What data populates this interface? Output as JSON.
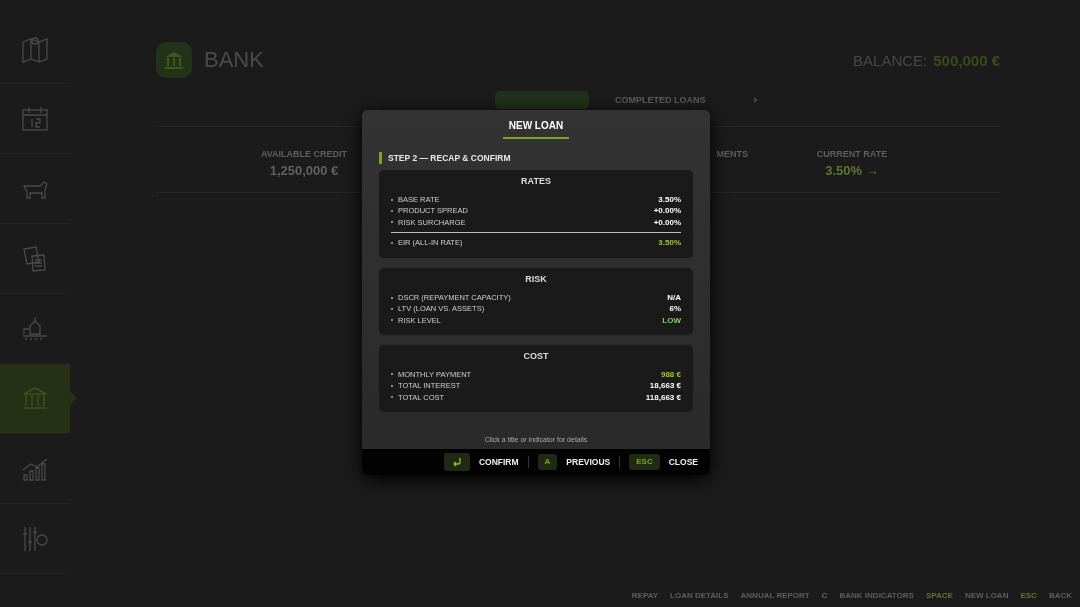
{
  "sidebar": {
    "items": [
      {
        "selected": false
      },
      {
        "selected": false
      },
      {
        "selected": false
      },
      {
        "selected": false
      },
      {
        "selected": false
      },
      {
        "selected": true
      },
      {
        "selected": false
      },
      {
        "selected": false
      }
    ]
  },
  "header": {
    "title": "BANK",
    "balance_label": "BALANCE:",
    "balance_value": "500,000 €"
  },
  "tabs": [
    {
      "selected": true
    },
    {
      "label": "COMPLETED LOANS",
      "selected": false
    }
  ],
  "stats": [
    {
      "label": "AVAILABLE CREDIT",
      "value": "1,250,000 €"
    },
    {
      "label": "MENTS"
    },
    {
      "label": "CURRENT RATE",
      "value": "3.50% →"
    }
  ],
  "dialog": {
    "title": "NEW LOAN",
    "step": "STEP 2 — RECAP & CONFIRM",
    "sections": [
      {
        "title": "RATES",
        "rows": [
          {
            "label": "BASE RATE",
            "value": "3.50%",
            "color": "#ffffff",
            "separated": false
          },
          {
            "label": "PRODUCT SPREAD",
            "value": "+0.00%",
            "color": "#ffffff",
            "separated": false
          },
          {
            "label": "RISK SURCHARGE",
            "value": "+0.00%",
            "color": "#ffffff",
            "separated": false
          },
          {
            "label": "EIR (ALL-IN RATE)",
            "value": "3.50%",
            "color": "#9ccc1c",
            "separated": true
          }
        ]
      },
      {
        "title": "RISK",
        "rows": [
          {
            "label": "DSCR (REPAYMENT CAPACITY)",
            "value": "N/A",
            "color": "#ffffff",
            "separated": false
          },
          {
            "label": "LTV (LOAN VS. ASSETS)",
            "value": "6%",
            "color": "#ffffff",
            "separated": false
          },
          {
            "label": "RISK LEVEL",
            "value": "LOW",
            "color": "#7fd25a",
            "separated": false
          }
        ]
      },
      {
        "title": "COST",
        "rows": [
          {
            "label": "MONTHLY PAYMENT",
            "value": "988 €",
            "color": "#9ccc1c",
            "separated": false
          },
          {
            "label": "TOTAL INTEREST",
            "value": "18,663 €",
            "color": "#ffffff",
            "separated": false
          },
          {
            "label": "TOTAL COST",
            "value": "118,663 €",
            "color": "#ffffff",
            "separated": false
          }
        ]
      }
    ],
    "hint": "Click a title or indicator for details",
    "actions": [
      {
        "kind": "icon",
        "label": "CONFIRM"
      },
      {
        "kind": "text",
        "key": "A",
        "label": "PREVIOUS"
      },
      {
        "kind": "text",
        "key": "ESC",
        "label": "CLOSE"
      }
    ]
  },
  "hints": [
    {
      "label": "REPAY"
    },
    {
      "label": "LOAN DETAILS"
    },
    {
      "label": "ANNUAL REPORT"
    },
    {
      "key": "C",
      "label": "BANK INDICATORS"
    },
    {
      "key": "SPACE",
      "label": "NEW LOAN"
    },
    {
      "key": "ESC",
      "label": "BACK"
    }
  ]
}
